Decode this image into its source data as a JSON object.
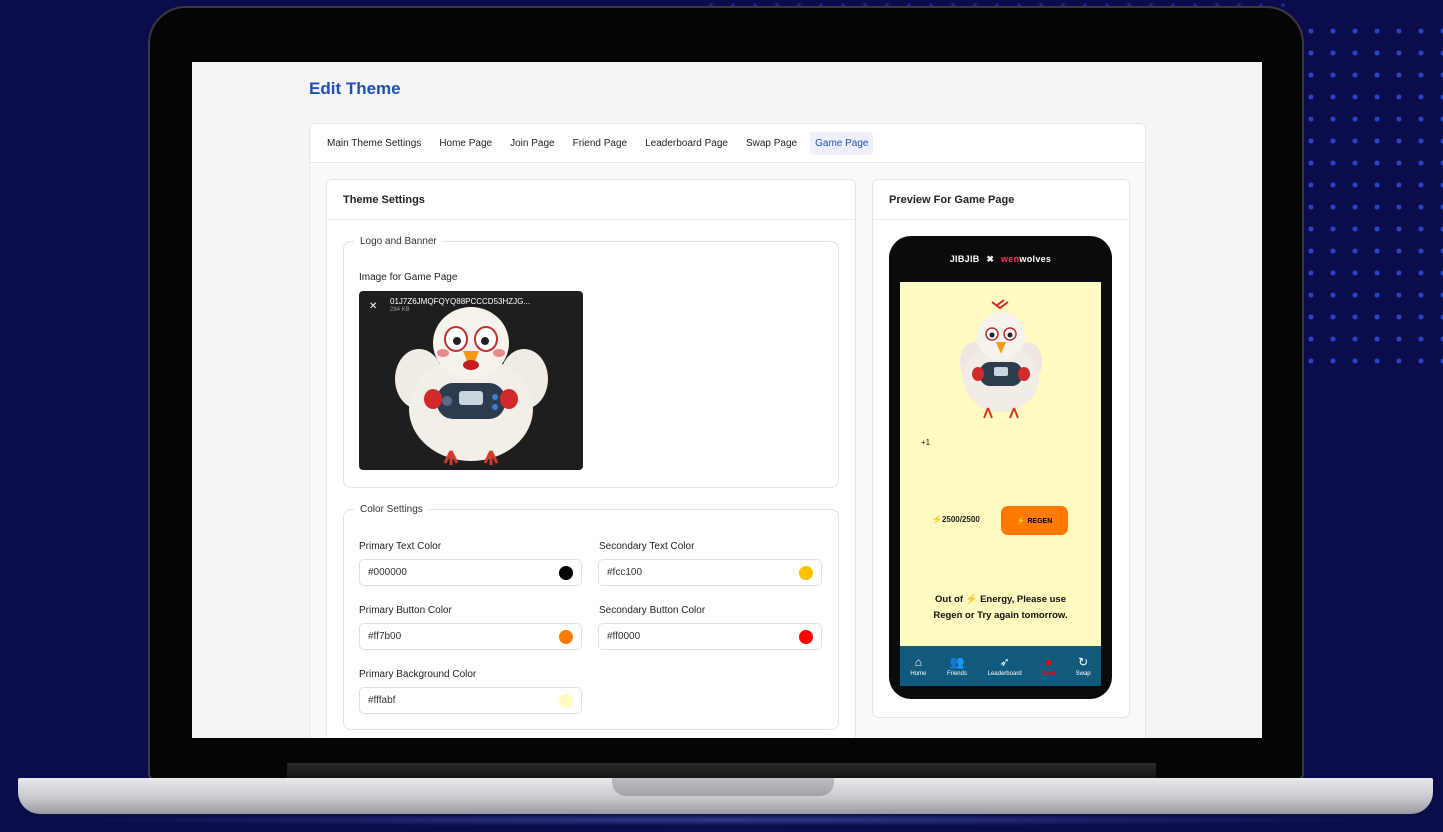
{
  "page": {
    "title": "Edit Theme"
  },
  "tabs": [
    {
      "label": "Main Theme Settings"
    },
    {
      "label": "Home Page"
    },
    {
      "label": "Join Page"
    },
    {
      "label": "Friend Page"
    },
    {
      "label": "Leaderboard Page"
    },
    {
      "label": "Swap Page"
    },
    {
      "label": "Game Page",
      "active": true
    }
  ],
  "settings": {
    "title": "Theme Settings",
    "logo_banner": {
      "legend": "Logo and Banner",
      "image_label": "Image for Game Page",
      "file_name": "01J7Z6JMQFQYQ88PCCCD53HZJG...",
      "file_size": "284 KB"
    },
    "colors": {
      "legend": "Color Settings",
      "primary_text": {
        "label": "Primary Text Color",
        "value": "#000000"
      },
      "secondary_text": {
        "label": "Secondary Text Color",
        "value": "#fcc100"
      },
      "primary_button": {
        "label": "Primary Button Color",
        "value": "#ff7b00"
      },
      "secondary_button": {
        "label": "Secondary Button Color",
        "value": "#ff0000"
      },
      "primary_background": {
        "label": "Primary Background Color",
        "value": "#fffabf"
      }
    }
  },
  "preview": {
    "title": "Preview For Game Page",
    "header_left": "JIBJIB",
    "header_x": "✖",
    "header_wen": "wen",
    "header_wolves": "wolves",
    "plus_one": "+1",
    "energy": "⚡2500/2500",
    "regen": "⚡ REGEN",
    "message_line1": "Out of ⚡ Energy, Please use",
    "message_line2": "Regen or Try again tomorrow.",
    "nav": [
      {
        "label": "Home",
        "icon": "home-icon"
      },
      {
        "label": "Friends",
        "icon": "friends-icon"
      },
      {
        "label": "Leaderboard",
        "icon": "rocket-icon"
      },
      {
        "label": "Earn",
        "icon": "gamepad-icon"
      },
      {
        "label": "Swap",
        "icon": "refresh-icon"
      }
    ]
  }
}
